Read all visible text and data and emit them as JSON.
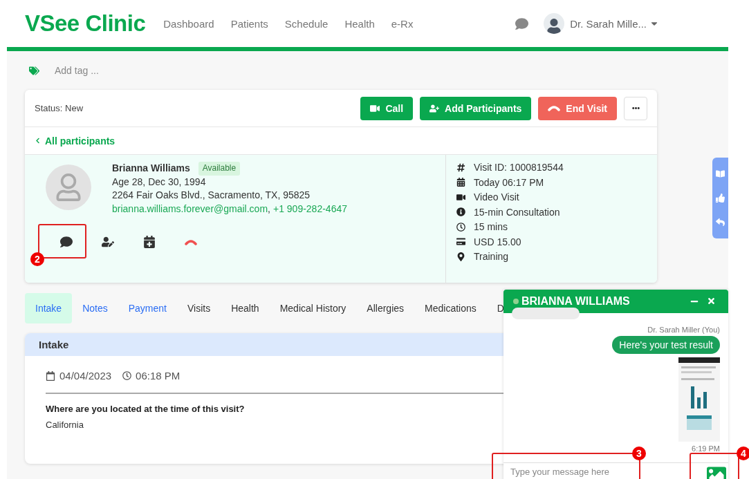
{
  "header": {
    "logo": "VSee Clinic",
    "nav": [
      {
        "label": "Dashboard"
      },
      {
        "label": "Patients"
      },
      {
        "label": "Schedule"
      },
      {
        "label": "Health"
      },
      {
        "label": "e-Rx"
      }
    ],
    "user": "Dr. Sarah Mille..."
  },
  "tag_field": {
    "placeholder": "Add tag ..."
  },
  "visit_bar": {
    "status": "Status: New",
    "buttons": [
      {
        "label": "Call",
        "kind": "call"
      },
      {
        "label": "Add Participants",
        "kind": "add"
      },
      {
        "label": "End Visit",
        "kind": "end"
      }
    ],
    "back_link": "All participants"
  },
  "patient": {
    "name": "Brianna Williams",
    "availability": "Available",
    "age": "Age 28, Dec 30, 1994",
    "address": "2264 Fair Oaks Blvd., Sacramento, TX, 95825",
    "email": "brianna.williams.forever@gmail.com",
    "separator": ",",
    "phone": "+1 909-282-4647",
    "actions": [
      {
        "kind": "chat"
      },
      {
        "kind": "edit"
      },
      {
        "kind": "schedule"
      },
      {
        "kind": "hangup"
      }
    ]
  },
  "visit_info": [
    {
      "kind": "id",
      "text": "Visit ID: 1000819544"
    },
    {
      "kind": "date",
      "text": "Today 06:17 PM"
    },
    {
      "kind": "video",
      "text": "Video Visit"
    },
    {
      "kind": "info",
      "text": "15-min Consultation"
    },
    {
      "kind": "duration",
      "text": "15 mins"
    },
    {
      "kind": "payment",
      "text": "USD 15.00"
    },
    {
      "kind": "location",
      "text": "Training"
    }
  ],
  "tabs": [
    {
      "label": "Intake",
      "selected": true,
      "linked": false
    },
    {
      "label": "Notes",
      "selected": false,
      "linked": true
    },
    {
      "label": "Payment",
      "selected": false,
      "linked": true
    },
    {
      "label": "Visits",
      "selected": false,
      "linked": false
    },
    {
      "label": "Health",
      "selected": false,
      "linked": false
    },
    {
      "label": "Medical History",
      "selected": false,
      "linked": false
    },
    {
      "label": "Allergies",
      "selected": false,
      "linked": false
    },
    {
      "label": "Medications",
      "selected": false,
      "linked": false
    },
    {
      "label": "D",
      "selected": false,
      "linked": false
    }
  ],
  "intake": {
    "title": "Intake",
    "date": "04/04/2023",
    "time": "06:18 PM",
    "question": "Where are you located at the time of this visit?",
    "answer": "California"
  },
  "chat": {
    "name": "BRIANNA WILLIAMS",
    "online": true,
    "sender": "Dr. Sarah Miller (You)",
    "message": "Here's your test result",
    "time": "6:19 PM",
    "input": {
      "placeholder": "Type your message here"
    }
  },
  "annotations": [
    {
      "number": "2"
    },
    {
      "number": "3"
    },
    {
      "number": "4"
    }
  ]
}
